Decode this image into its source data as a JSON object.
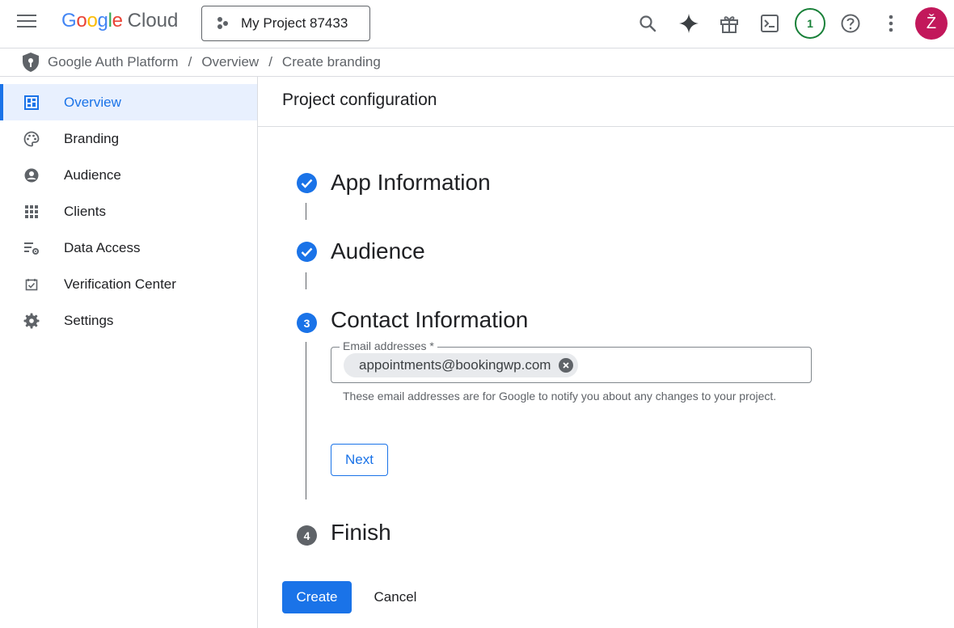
{
  "header": {
    "brand_google": "Google",
    "brand_cloud": "Cloud",
    "project_label": "My Project 87433",
    "notification_count": "1",
    "avatar_letter": "Ž"
  },
  "breadcrumb": {
    "items": [
      "Google Auth Platform",
      "Overview",
      "Create branding"
    ],
    "separator": "/"
  },
  "sidebar": {
    "items": [
      {
        "label": "Overview",
        "icon": "dashboard-icon",
        "active": true
      },
      {
        "label": "Branding",
        "icon": "palette-icon"
      },
      {
        "label": "Audience",
        "icon": "account-circle-icon"
      },
      {
        "label": "Clients",
        "icon": "apps-grid-icon"
      },
      {
        "label": "Data Access",
        "icon": "data-access-icon"
      },
      {
        "label": "Verification Center",
        "icon": "checkbox-icon"
      },
      {
        "label": "Settings",
        "icon": "gear-icon"
      }
    ]
  },
  "main": {
    "title": "Project configuration",
    "steps": [
      {
        "label": "App Information",
        "status": "complete"
      },
      {
        "label": "Audience",
        "status": "complete"
      },
      {
        "label": "Contact Information",
        "status": "current",
        "number": "3"
      },
      {
        "label": "Finish",
        "status": "todo",
        "number": "4"
      }
    ],
    "email_field": {
      "label": "Email addresses *",
      "chip": "appointments@bookingwp.com",
      "helper": "These email addresses are for Google to notify you about any changes to your project."
    },
    "next_label": "Next",
    "create_label": "Create",
    "cancel_label": "Cancel"
  },
  "colors": {
    "accent": "#1a73e8",
    "active_bg": "#e8f0fe",
    "avatar_bg": "#c2185b",
    "notif_green": "#188038"
  }
}
